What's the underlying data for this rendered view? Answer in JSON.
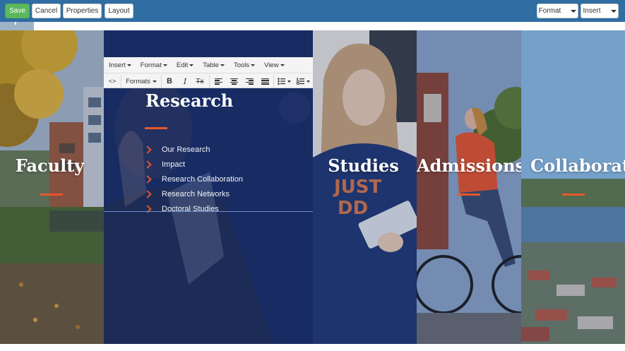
{
  "toolbar": {
    "save_label": "Save",
    "cancel_label": "Cancel",
    "properties_label": "Properties",
    "layout_label": "Layout",
    "format_label": "Format",
    "insert_label": "Insert"
  },
  "editor": {
    "menus": [
      "Insert",
      "Format",
      "Edit",
      "Table",
      "Tools",
      "View"
    ],
    "formats_label": "Formats",
    "source_code_label": "<>",
    "bold_label": "B",
    "italic_label": "I",
    "clear_format_label": "Tx"
  },
  "panels": {
    "faculty": {
      "title": "Faculty"
    },
    "research": {
      "title": "Research",
      "links": [
        "Our Research",
        "Impact",
        "Research Collaboration",
        "Research Networks",
        "Doctoral Studies"
      ]
    },
    "studies": {
      "title": "Studies"
    },
    "admissions": {
      "title": "Admissions"
    },
    "collaboration": {
      "title": "Collaboratio"
    }
  },
  "colors": {
    "toolbar_bg": "#2f6da3",
    "save_green": "#5cb85c",
    "accent_orange": "#e8562a",
    "research_navy": "#1b2d5e"
  }
}
